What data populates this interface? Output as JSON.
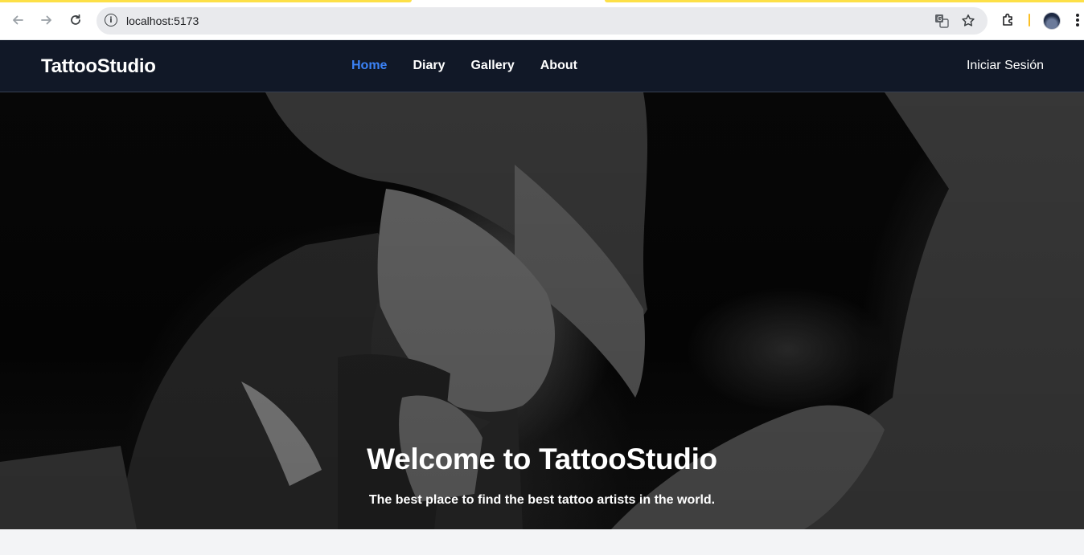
{
  "browser": {
    "url": "localhost:5173",
    "icons": [
      "back-arrow-icon",
      "forward-arrow-icon",
      "reload-icon",
      "site-info-icon",
      "translate-icon",
      "bookmark-star-icon",
      "extensions-icon",
      "profile-avatar",
      "menu-dots-icon"
    ]
  },
  "navbar": {
    "brand": "TattooStudio",
    "links": [
      {
        "label": "Home",
        "active": true
      },
      {
        "label": "Diary",
        "active": false
      },
      {
        "label": "Gallery",
        "active": false
      },
      {
        "label": "About",
        "active": false
      }
    ],
    "login_label": "Iniciar Sesión"
  },
  "hero": {
    "title": "Welcome to TattooStudio",
    "subtitle": "The best place to find the best tattoo artists in the world."
  },
  "colors": {
    "navbar_bg": "#111827",
    "active_link": "#3b82f6",
    "page_bg": "#f3f4f6",
    "chrome_accent": "#fde047"
  }
}
